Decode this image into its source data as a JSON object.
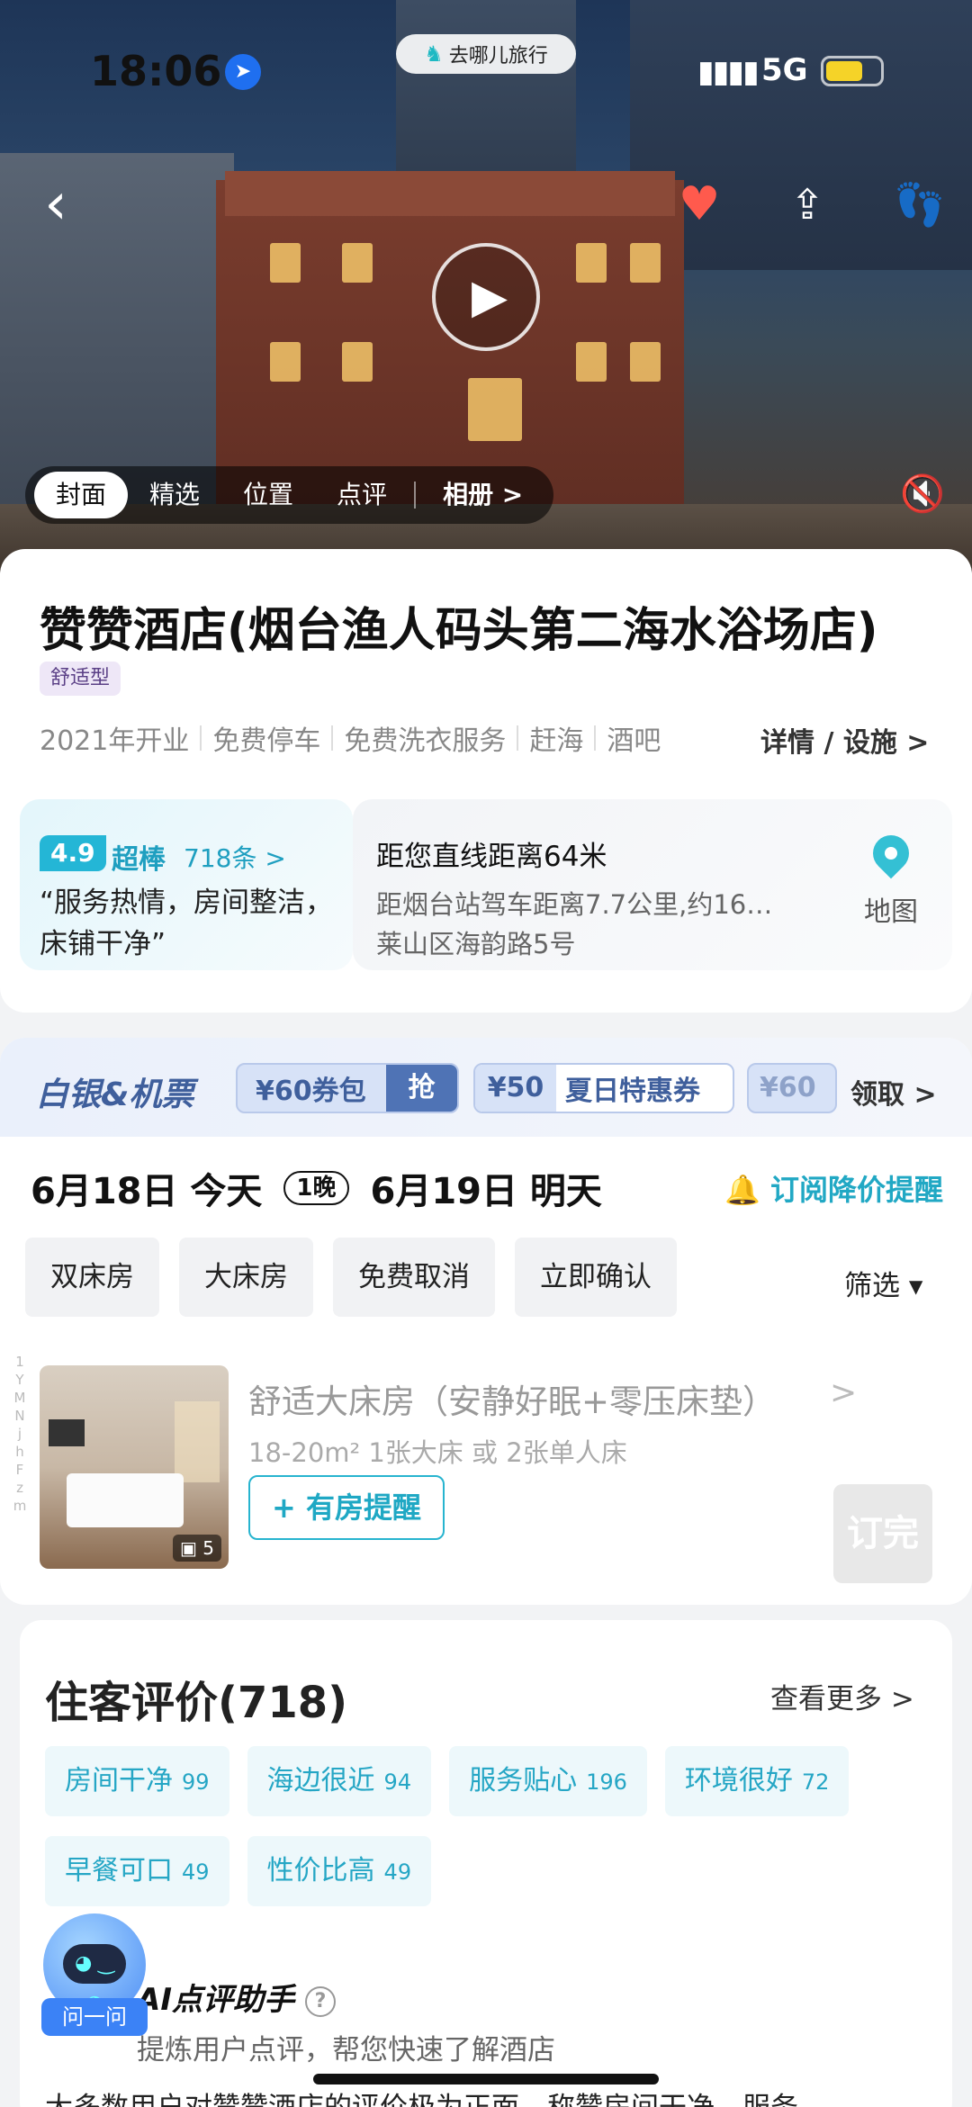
{
  "status": {
    "time": "18:06",
    "network": "5G",
    "signal": "▮▮▮▮",
    "location_icon": "location-arrow-icon",
    "battery_color": "#f5d328"
  },
  "brand": {
    "name": "去哪儿旅行",
    "icon": "camel-icon"
  },
  "header": {
    "back_icon": "chevron-left-icon",
    "heart_icon": "heart-icon",
    "heart_color": "#ff5a4d",
    "share_icon": "share-icon",
    "footprint_icon": "footprint-icon",
    "play_icon": "play-icon",
    "mute_icon": "speaker-muted-icon"
  },
  "gallery_tabs": [
    {
      "label": "封面",
      "active": true
    },
    {
      "label": "精选"
    },
    {
      "label": "位置"
    },
    {
      "label": "点评"
    },
    {
      "label": "相册 >"
    }
  ],
  "hotel": {
    "name": "赞赞酒店(烟台渔人码头第二海水浴场店)",
    "type_tag": "舒适型",
    "features": [
      "2021年开业",
      "免费停车",
      "免费洗衣服务",
      "赶海",
      "酒吧"
    ],
    "detail_link": "详情 / 设施 >"
  },
  "rating": {
    "score": "4.9",
    "label": "超棒",
    "count": "718条 >",
    "quote": "“服务热情，房间整洁，床铺干净”",
    "accent": "#24b6d6"
  },
  "location": {
    "distance": "距您直线距离64米",
    "drive": "距烟台站驾车距离7.7公里,约16…",
    "address": "莱山区海韵路5号",
    "map_label": "地图",
    "map_icon": "map-pin-icon"
  },
  "coupons": {
    "brand": "白银&机票",
    "pack_amount": "¥60券包",
    "pack_action": "抢",
    "coupon2_amount": "¥50",
    "coupon2_label": "夏日特惠券",
    "coupon3_amount": "¥60",
    "claim": "领取 >"
  },
  "dates": {
    "checkin": "6月18日 今天",
    "nights": "1晚",
    "checkout": "6月19日 明天",
    "price_alert": "🔔 订阅降价提醒"
  },
  "filters": {
    "chips": [
      "双床房",
      "大床房",
      "免费取消",
      "立即确认"
    ],
    "filter_button": "筛选 ▾"
  },
  "room": {
    "side_letters": "1\nY\nM\nN\nj\nh\nF\nz\nm",
    "name": "舒适大床房（安静好眠+零压床垫）",
    "chevron": ">",
    "meta": "18-20m²    1张大床 或 2张单人床",
    "photo_count": "5",
    "alert_button": "+ 有房提醒",
    "status": "订完"
  },
  "reviews": {
    "title": "住客评价(718)",
    "more": "查看更多 >",
    "tags": [
      {
        "label": "房间干净",
        "count": "99"
      },
      {
        "label": "海边很近",
        "count": "94"
      },
      {
        "label": "服务贴心",
        "count": "196"
      },
      {
        "label": "环境很好",
        "count": "72"
      },
      {
        "label": "早餐可口",
        "count": "49"
      },
      {
        "label": "性价比高",
        "count": "49"
      }
    ],
    "ai_title": "AI点评助手",
    "ai_help": "?",
    "ai_subtitle": "提炼用户点评，帮您快速了解酒店",
    "ai_body": "大多数用户对赞赞酒店的评价极为正面，称赞房间干净、服务"
  },
  "assistant": {
    "label": "问一问",
    "face": "◕ ‿ ◕"
  }
}
